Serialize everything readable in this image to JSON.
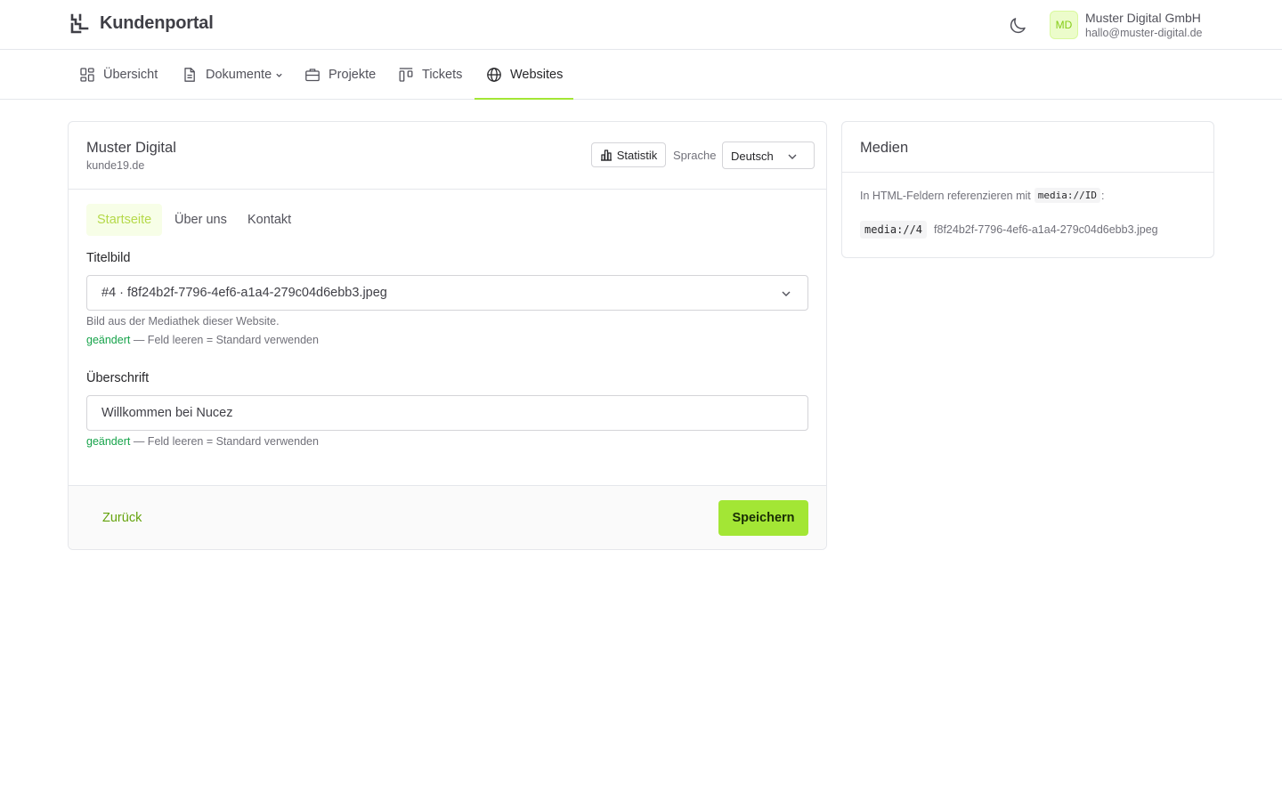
{
  "header": {
    "app_name": "Kundenportal",
    "theme_toggle_icon": "moon-icon",
    "user": {
      "initials": "MD",
      "name": "Muster Digital GmbH",
      "email": "hallo@muster-digital.de"
    }
  },
  "nav": {
    "items": [
      {
        "label": "Übersicht",
        "icon": "dashboard-icon"
      },
      {
        "label": "Dokumente",
        "icon": "document-icon",
        "has_dropdown": true
      },
      {
        "label": "Projekte",
        "icon": "briefcase-icon"
      },
      {
        "label": "Tickets",
        "icon": "kanban-icon"
      },
      {
        "label": "Websites",
        "icon": "globe-icon",
        "active": true
      }
    ]
  },
  "site": {
    "title": "Muster Digital",
    "domain": "kunde19.de",
    "stats_label": "Statistik",
    "language_label": "Sprache",
    "language_value": "Deutsch"
  },
  "tabs": [
    {
      "label": "Startseite",
      "active": true
    },
    {
      "label": "Über uns"
    },
    {
      "label": "Kontakt"
    }
  ],
  "form": {
    "title_image": {
      "label": "Titelbild",
      "value": "#4 · f8f24b2f-7796-4ef6-a1a4-279c04d6ebb3.jpeg",
      "help": "Bild aus der Mediathek dieser Website.",
      "changed": "geändert",
      "reset_hint": " — Feld leeren = Standard verwenden"
    },
    "heading": {
      "label": "Überschrift",
      "value": "Willkommen bei Nucez",
      "changed": "geändert",
      "reset_hint": " — Feld leeren = Standard verwenden"
    }
  },
  "footer": {
    "back_label": "Zurück",
    "save_label": "Speichern"
  },
  "media": {
    "title": "Medien",
    "hint_prefix": "In HTML-Feldern referenzieren mit",
    "hint_code": "media://ID",
    "hint_suffix": ":",
    "items": [
      {
        "ref": "media://4",
        "filename": "f8f24b2f-7796-4ef6-a1a4-279c04d6ebb3.jpeg"
      }
    ]
  },
  "colors": {
    "accent": "#a3e635",
    "accent_text": "#65a30d",
    "changed": "#16a34a"
  }
}
